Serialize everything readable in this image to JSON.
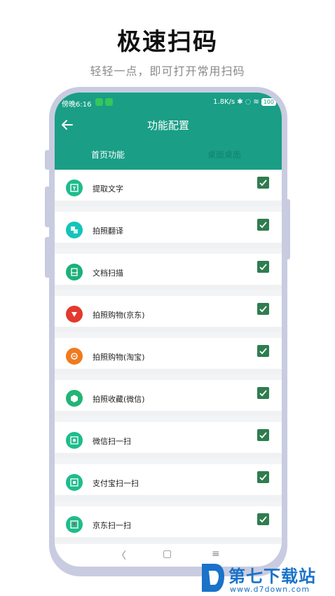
{
  "promo": {
    "title": "极速扫码",
    "subtitle": "轻轻一点，即可打开常用扫码"
  },
  "status_bar": {
    "time": "傍晚6:16",
    "speed": "1.8K/s",
    "battery": "100"
  },
  "header": {
    "title": "功能配置",
    "tabs": [
      {
        "label": "首页功能",
        "active": true
      },
      {
        "label": "桌面桌面",
        "active": false
      }
    ]
  },
  "items": [
    {
      "label": "提取文字",
      "icon": "text-extract-icon",
      "icon_color": "#1ebc8c",
      "checked": true
    },
    {
      "label": "拍照翻译",
      "icon": "translate-icon",
      "icon_color": "#14c4b8",
      "checked": true
    },
    {
      "label": "文档扫描",
      "icon": "document-scan-icon",
      "icon_color": "#1db07a",
      "checked": true
    },
    {
      "label": "拍照购物(京东)",
      "icon": "jd-icon",
      "icon_color": "#e23a2e",
      "checked": true
    },
    {
      "label": "拍照购物(淘宝)",
      "icon": "taobao-icon",
      "icon_color": "#f07a1e",
      "checked": true
    },
    {
      "label": "拍照收藏(微信)",
      "icon": "wechat-favorite-icon",
      "icon_color": "#22b573",
      "checked": true
    },
    {
      "label": "微信扫一扫",
      "icon": "wechat-scan-icon",
      "icon_color": "#1ebc8c",
      "checked": true
    },
    {
      "label": "支付宝扫一扫",
      "icon": "alipay-scan-icon",
      "icon_color": "#1ebc8c",
      "checked": true
    },
    {
      "label": "京东扫一扫",
      "icon": "jd-scan-icon",
      "icon_color": "#1ebc8c",
      "checked": true
    }
  ],
  "navbar": {
    "back": "〈",
    "home": "▢",
    "menu": "≡"
  },
  "watermark": {
    "name": "第七下载站",
    "url": "www.d7down.com"
  },
  "colors": {
    "accent": "#1a9e86",
    "check": "#2e7d4f",
    "frame": "#c9cce0",
    "watermark": "#1a72c9"
  }
}
